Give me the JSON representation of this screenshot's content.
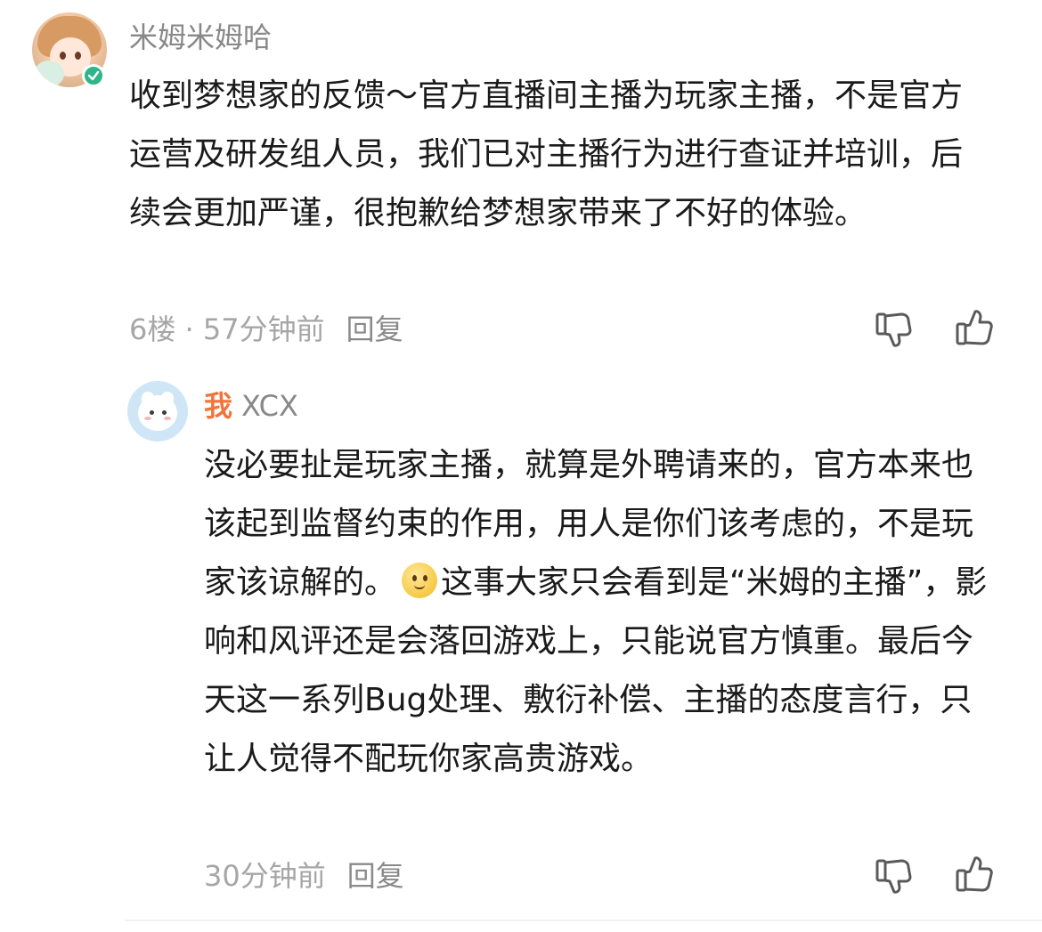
{
  "comment": {
    "username": "米姆米姆哈",
    "text": "收到梦想家的反馈～官方直播间主播为玩家主播，不是官方运营及研发组人员，我们已对主播行为进行查证并培训，后续会更加严谨，很抱歉给梦想家带来了不好的体验。",
    "floor": "6楼",
    "separator": " · ",
    "time": "57分钟前",
    "reply_label": "回复"
  },
  "reply": {
    "me_label": "我",
    "username": "XCX",
    "text_before_emoji": "没必要扯是玩家主播，就算是外聘请来的，官方本来也该起到监督约束的作用，用人是你们该考虑的，不是玩家该谅解的。",
    "emoji_name": "smirk-emoji",
    "text_after_emoji": "这事大家只会看到是“米姆的主播”，影响和风评还是会落回游戏上，只能说官方慎重。最后今天这一系列Bug处理、敷衍补偿、主播的态度言行，只让人觉得不配玩你家高贵游戏。",
    "time": "30分钟前",
    "reply_label": "回复"
  },
  "icons": {
    "dislike": "thumbs-down-icon",
    "like": "thumbs-up-icon",
    "verified": "verified-check-icon"
  },
  "colors": {
    "username": "#888888",
    "body": "#1a1a1a",
    "meta": "#a6a6a6",
    "me_tag": "#f2743a",
    "verified": "#2fb58a"
  }
}
